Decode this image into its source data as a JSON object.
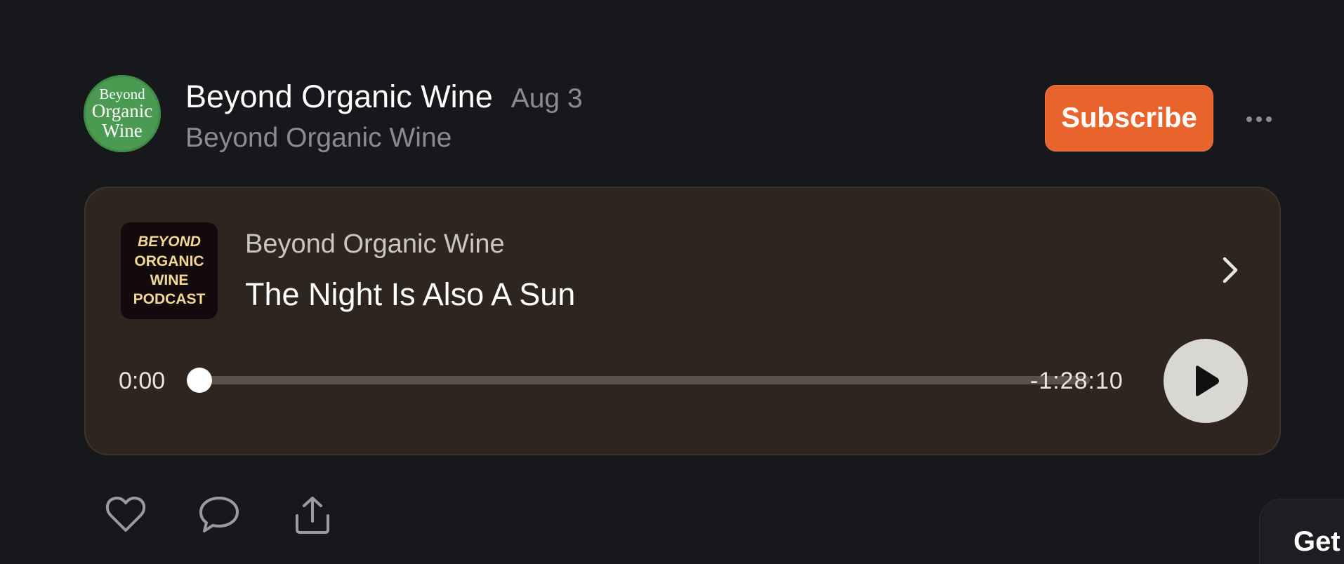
{
  "header": {
    "avatar_lines": [
      "Beyond",
      "Organic",
      "Wine"
    ],
    "publication_name": "Beyond Organic Wine",
    "date": "Aug 3",
    "author": "Beyond Organic Wine",
    "subscribe_label": "Subscribe",
    "more_icon": "more-horizontal-icon"
  },
  "player": {
    "cover_lines": [
      "BEYOND",
      "ORGANIC",
      "WINE",
      "PODCAST"
    ],
    "show_name": "Beyond Organic Wine",
    "episode_title": "The Night Is Also A Sun",
    "elapsed": "0:00",
    "remaining": "-1:28:10",
    "progress_fraction": 0.0,
    "chevron_icon": "chevron-right-icon",
    "play_icon": "play-icon"
  },
  "actions": {
    "like_icon": "heart-icon",
    "comment_icon": "comment-icon",
    "share_icon": "share-icon"
  },
  "get_app": {
    "label": "Get"
  },
  "colors": {
    "background": "#17181b",
    "accent": "#e8642c",
    "card": "#2e261e",
    "muted_text": "#8a8b8f"
  }
}
